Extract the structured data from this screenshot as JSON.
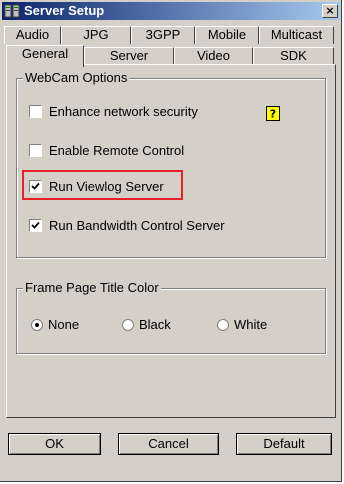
{
  "window": {
    "title": "Server Setup",
    "close_glyph": "×"
  },
  "tabs_back_row": [
    "Audio",
    "JPG",
    "3GPP",
    "Mobile",
    "Multicast"
  ],
  "tabs_front_row": [
    "General",
    "Server",
    "Video",
    "SDK"
  ],
  "active_tab": "General",
  "webcam_options": {
    "title": "WebCam Options",
    "items": [
      {
        "label": "Enhance network security",
        "checked": false
      },
      {
        "label": "Enable Remote Control",
        "checked": false
      },
      {
        "label": "Run Viewlog Server",
        "checked": true
      },
      {
        "label": "Run Bandwidth Control Server",
        "checked": true
      }
    ],
    "help_icon": "question-icon",
    "highlighted_item": "Run Viewlog Server",
    "highlight_color": "#e8202a"
  },
  "frame_color": {
    "title": "Frame Page Title Color",
    "options": [
      {
        "label": "None",
        "selected": true
      },
      {
        "label": "Black",
        "selected": false
      },
      {
        "label": "White",
        "selected": false
      }
    ]
  },
  "buttons": {
    "ok": "OK",
    "cancel": "Cancel",
    "default": "Default"
  },
  "colors": {
    "dialog_bg": "#d4d0c8",
    "title_bar": "#0a246a"
  }
}
